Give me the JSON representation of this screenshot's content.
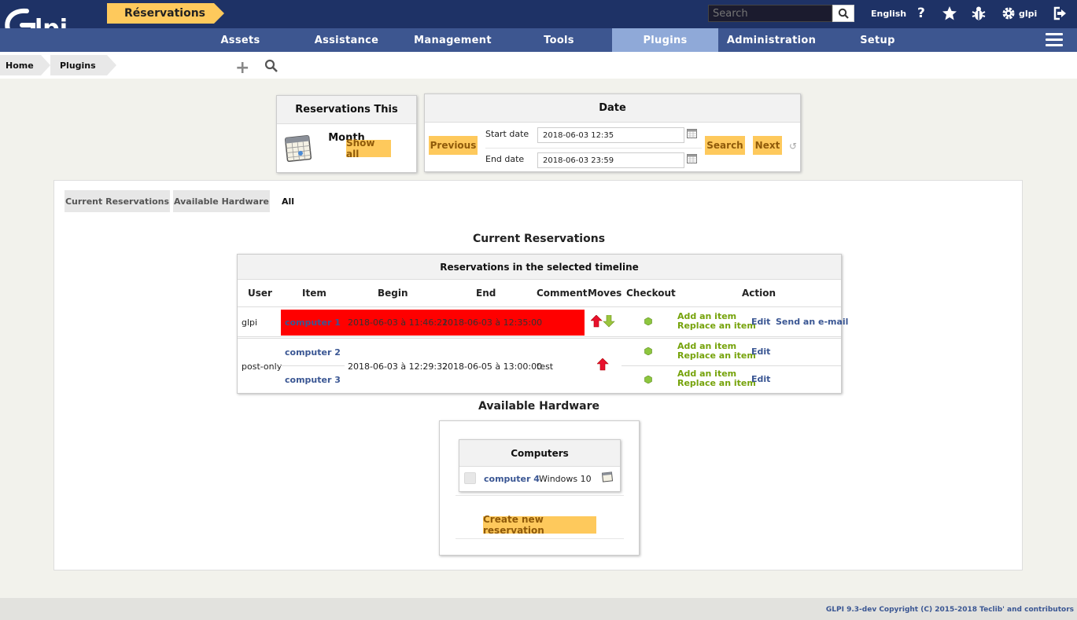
{
  "header": {
    "logo_text": "Glpi",
    "search_placeholder": "Search",
    "language": "English",
    "help_icon": "?",
    "user": "glpi",
    "icons": [
      "search-icon",
      "help-icon",
      "star-icon",
      "bug-icon",
      "gear-icon",
      "logout-icon"
    ]
  },
  "menu": {
    "items": [
      "Assets",
      "Assistance",
      "Management",
      "Tools",
      "Plugins",
      "Administration",
      "Setup"
    ],
    "active": "Plugins"
  },
  "breadcrumb": {
    "home": "Home",
    "plugins": "Plugins",
    "current": "Réservations"
  },
  "month_panel": {
    "title": "Reservations This Month",
    "show_all": "Show all"
  },
  "date_panel": {
    "title": "Date",
    "previous": "Previous",
    "start_label": "Start date",
    "start_value": "2018-06-03 12:35",
    "end_label": "End date",
    "end_value": "2018-06-03 23:59",
    "search": "Search",
    "next": "Next"
  },
  "tabs": [
    "Current Reservations",
    "Available Hardware",
    "All"
  ],
  "current_reservations": {
    "section_title": "Current Reservations",
    "table_title": "Reservations in the selected timeline",
    "columns": [
      "User",
      "Item",
      "Begin",
      "End",
      "Comment",
      "Moves",
      "Checkout",
      "Action"
    ],
    "rows": [
      {
        "user": "glpi",
        "item": "computer 1",
        "begin": "2018-06-03 à 11:46:21",
        "end": "2018-06-03 à 12:35:00",
        "comment": "",
        "add_item": "Add an item",
        "replace_item": "Replace an item",
        "edit": "Edit",
        "send_email": "Send an e-mail",
        "highlight_color": "#ff0000"
      },
      {
        "user": "post-only",
        "items": [
          "computer 2",
          "computer 3"
        ],
        "begin": "2018-06-03 à 12:29:32",
        "end": "2018-06-05 à 13:00:00",
        "comment": "test",
        "add_item": "Add an item",
        "replace_item": "Replace an item",
        "edit": "Edit"
      }
    ]
  },
  "available_hardware": {
    "section_title": "Available Hardware",
    "group_title": "Computers",
    "item_name": "computer 4",
    "item_os": "Windows 10",
    "create_button": "Create new reservation"
  },
  "footer": {
    "text": "GLPI 9.3-dev Copyright (C) 2015-2018 Teclib' and contributors"
  },
  "colors": {
    "header_bg": "#1e3266",
    "menu_bg": "#3d5690",
    "menu_active": "#8fa9d8",
    "button_bg": "#fec95c",
    "link_blue": "#3a5693",
    "link_green": "#76a30b"
  }
}
